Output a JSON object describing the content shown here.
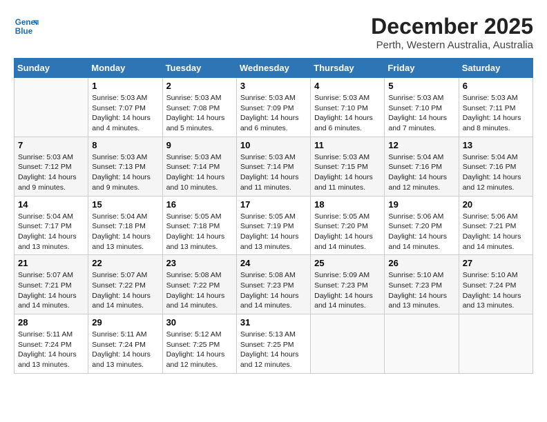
{
  "logo": {
    "line1": "General",
    "line2": "Blue"
  },
  "title": "December 2025",
  "subtitle": "Perth, Western Australia, Australia",
  "days_of_week": [
    "Sunday",
    "Monday",
    "Tuesday",
    "Wednesday",
    "Thursday",
    "Friday",
    "Saturday"
  ],
  "weeks": [
    [
      {
        "day": "",
        "info": ""
      },
      {
        "day": "1",
        "info": "Sunrise: 5:03 AM\nSunset: 7:07 PM\nDaylight: 14 hours\nand 4 minutes."
      },
      {
        "day": "2",
        "info": "Sunrise: 5:03 AM\nSunset: 7:08 PM\nDaylight: 14 hours\nand 5 minutes."
      },
      {
        "day": "3",
        "info": "Sunrise: 5:03 AM\nSunset: 7:09 PM\nDaylight: 14 hours\nand 6 minutes."
      },
      {
        "day": "4",
        "info": "Sunrise: 5:03 AM\nSunset: 7:10 PM\nDaylight: 14 hours\nand 6 minutes."
      },
      {
        "day": "5",
        "info": "Sunrise: 5:03 AM\nSunset: 7:10 PM\nDaylight: 14 hours\nand 7 minutes."
      },
      {
        "day": "6",
        "info": "Sunrise: 5:03 AM\nSunset: 7:11 PM\nDaylight: 14 hours\nand 8 minutes."
      }
    ],
    [
      {
        "day": "7",
        "info": "Sunrise: 5:03 AM\nSunset: 7:12 PM\nDaylight: 14 hours\nand 9 minutes."
      },
      {
        "day": "8",
        "info": "Sunrise: 5:03 AM\nSunset: 7:13 PM\nDaylight: 14 hours\nand 9 minutes."
      },
      {
        "day": "9",
        "info": "Sunrise: 5:03 AM\nSunset: 7:14 PM\nDaylight: 14 hours\nand 10 minutes."
      },
      {
        "day": "10",
        "info": "Sunrise: 5:03 AM\nSunset: 7:14 PM\nDaylight: 14 hours\nand 11 minutes."
      },
      {
        "day": "11",
        "info": "Sunrise: 5:03 AM\nSunset: 7:15 PM\nDaylight: 14 hours\nand 11 minutes."
      },
      {
        "day": "12",
        "info": "Sunrise: 5:04 AM\nSunset: 7:16 PM\nDaylight: 14 hours\nand 12 minutes."
      },
      {
        "day": "13",
        "info": "Sunrise: 5:04 AM\nSunset: 7:16 PM\nDaylight: 14 hours\nand 12 minutes."
      }
    ],
    [
      {
        "day": "14",
        "info": "Sunrise: 5:04 AM\nSunset: 7:17 PM\nDaylight: 14 hours\nand 13 minutes."
      },
      {
        "day": "15",
        "info": "Sunrise: 5:04 AM\nSunset: 7:18 PM\nDaylight: 14 hours\nand 13 minutes."
      },
      {
        "day": "16",
        "info": "Sunrise: 5:05 AM\nSunset: 7:18 PM\nDaylight: 14 hours\nand 13 minutes."
      },
      {
        "day": "17",
        "info": "Sunrise: 5:05 AM\nSunset: 7:19 PM\nDaylight: 14 hours\nand 13 minutes."
      },
      {
        "day": "18",
        "info": "Sunrise: 5:05 AM\nSunset: 7:20 PM\nDaylight: 14 hours\nand 14 minutes."
      },
      {
        "day": "19",
        "info": "Sunrise: 5:06 AM\nSunset: 7:20 PM\nDaylight: 14 hours\nand 14 minutes."
      },
      {
        "day": "20",
        "info": "Sunrise: 5:06 AM\nSunset: 7:21 PM\nDaylight: 14 hours\nand 14 minutes."
      }
    ],
    [
      {
        "day": "21",
        "info": "Sunrise: 5:07 AM\nSunset: 7:21 PM\nDaylight: 14 hours\nand 14 minutes."
      },
      {
        "day": "22",
        "info": "Sunrise: 5:07 AM\nSunset: 7:22 PM\nDaylight: 14 hours\nand 14 minutes."
      },
      {
        "day": "23",
        "info": "Sunrise: 5:08 AM\nSunset: 7:22 PM\nDaylight: 14 hours\nand 14 minutes."
      },
      {
        "day": "24",
        "info": "Sunrise: 5:08 AM\nSunset: 7:23 PM\nDaylight: 14 hours\nand 14 minutes."
      },
      {
        "day": "25",
        "info": "Sunrise: 5:09 AM\nSunset: 7:23 PM\nDaylight: 14 hours\nand 14 minutes."
      },
      {
        "day": "26",
        "info": "Sunrise: 5:10 AM\nSunset: 7:23 PM\nDaylight: 14 hours\nand 13 minutes."
      },
      {
        "day": "27",
        "info": "Sunrise: 5:10 AM\nSunset: 7:24 PM\nDaylight: 14 hours\nand 13 minutes."
      }
    ],
    [
      {
        "day": "28",
        "info": "Sunrise: 5:11 AM\nSunset: 7:24 PM\nDaylight: 14 hours\nand 13 minutes."
      },
      {
        "day": "29",
        "info": "Sunrise: 5:11 AM\nSunset: 7:24 PM\nDaylight: 14 hours\nand 13 minutes."
      },
      {
        "day": "30",
        "info": "Sunrise: 5:12 AM\nSunset: 7:25 PM\nDaylight: 14 hours\nand 12 minutes."
      },
      {
        "day": "31",
        "info": "Sunrise: 5:13 AM\nSunset: 7:25 PM\nDaylight: 14 hours\nand 12 minutes."
      },
      {
        "day": "",
        "info": ""
      },
      {
        "day": "",
        "info": ""
      },
      {
        "day": "",
        "info": ""
      }
    ]
  ]
}
